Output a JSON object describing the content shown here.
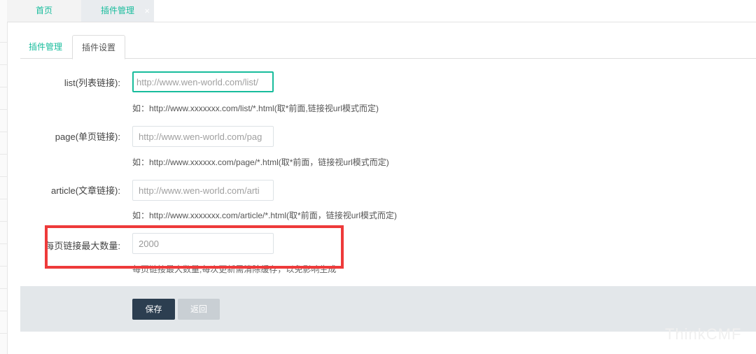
{
  "top_tabs": {
    "home": "首页",
    "plugin_manage": "插件管理",
    "close_glyph": "×"
  },
  "inner_tabs": {
    "manage": "插件管理",
    "settings": "插件设置"
  },
  "form": {
    "list": {
      "label": "list(列表链接):",
      "value": "http://www.wen-world.com/list/",
      "hint": "如：http://www.xxxxxxx.com/list/*.html(取*前面,链接视url模式而定)"
    },
    "page": {
      "label": "page(单页链接):",
      "value": "http://www.wen-world.com/pag",
      "hint": "如：http://www.xxxxxx.com/page/*.html(取*前面，链接视url模式而定)"
    },
    "article": {
      "label": "article(文章链接):",
      "value": "http://www.wen-world.com/arti",
      "hint": "如：http://www.xxxxxxx.com/article/*.html(取*前面，链接视url模式而定)"
    },
    "max_links": {
      "label": "每页链接最大数量:",
      "value": "2000",
      "hint": "每页链接最大数量,每次更新需清除缓存，以免影响生成"
    }
  },
  "actions": {
    "save": "保存",
    "back": "返回"
  },
  "watermark": "ThinkCMF",
  "colors": {
    "accent": "#18bc9c",
    "primary_button": "#2c3e50",
    "highlight_box": "#ee3a3a"
  }
}
